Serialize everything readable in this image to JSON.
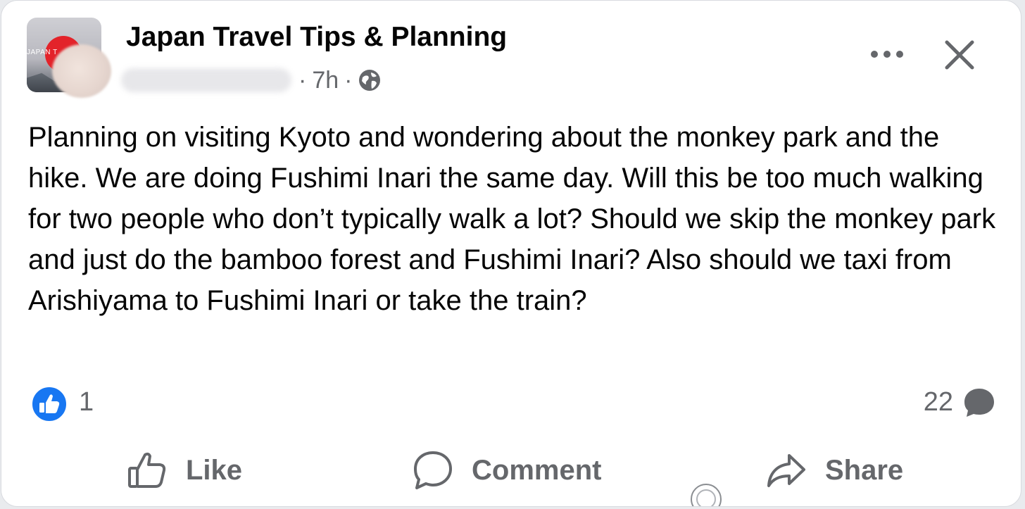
{
  "post": {
    "group_avatar_text": "JAPAN T",
    "group_name": "Japan Travel Tips & Planning",
    "time_separator": "·",
    "time": "7h",
    "time_separator_2": "·",
    "privacy_icon": "globe-icon",
    "more_icon": "more-horizontal-icon",
    "close_icon": "close-icon",
    "text": "Planning on visiting Kyoto and wondering about the monkey park and the hike. We are doing Fushimi Inari the same day. Will this be too much walking for two people who don’t typically walk a lot? Should we skip the monkey park and just do the bamboo forest and Fushimi Inari? Also should we taxi from Arishiyama to Fushimi Inari or take the train?"
  },
  "engagement": {
    "reaction_icon": "like-reaction-icon",
    "reaction_count": "1",
    "comment_count": "22",
    "comment_icon": "comment-bubble-icon"
  },
  "actions": {
    "like_label": "Like",
    "comment_label": "Comment",
    "share_label": "Share"
  },
  "colors": {
    "text_primary": "#050505",
    "text_secondary": "#65676b",
    "like_blue": "#1877f2",
    "group_sun_red": "#e3232a"
  }
}
